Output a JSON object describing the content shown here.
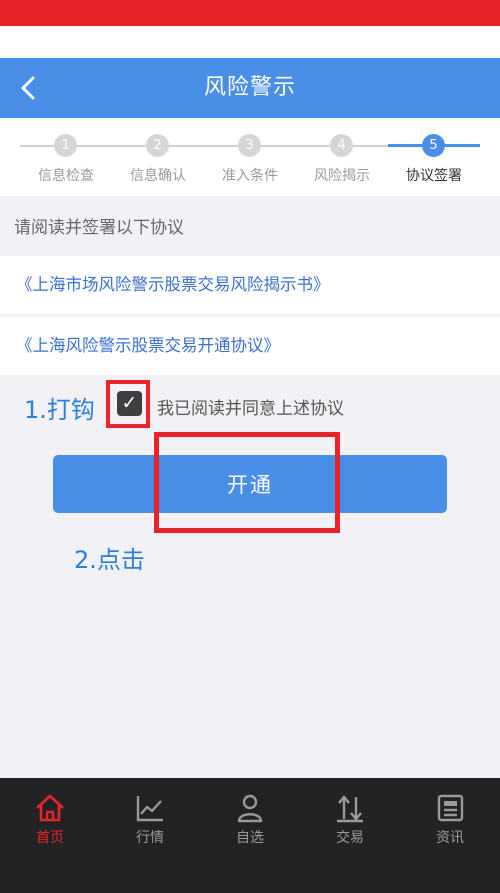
{
  "nav": {
    "title": "风险警示",
    "back_icon": "chevron-left-icon"
  },
  "steps": [
    {
      "num": "1",
      "label": "信息检查",
      "active": false
    },
    {
      "num": "2",
      "label": "信息确认",
      "active": false
    },
    {
      "num": "3",
      "label": "准入条件",
      "active": false
    },
    {
      "num": "4",
      "label": "风险揭示",
      "active": false
    },
    {
      "num": "5",
      "label": "协议签署",
      "active": true
    }
  ],
  "main": {
    "intro": "请阅读并签署以下协议",
    "protocols": [
      "《上海市场风险警示股票交易风险揭示书》",
      "《上海风险警示股票交易开通协议》"
    ],
    "agree_text": "我已阅读并同意上述协议",
    "agree_checked": true,
    "open_button": "开通"
  },
  "annotations": {
    "step1": "1.打钩",
    "step2": "2.点击",
    "highlight_color": "#e8232a",
    "text_color": "#2b7fd8"
  },
  "tabbar": [
    {
      "label": "首页",
      "icon": "home-icon",
      "active": true
    },
    {
      "label": "行情",
      "icon": "chart-icon",
      "active": false
    },
    {
      "label": "自选",
      "icon": "person-icon",
      "active": false
    },
    {
      "label": "交易",
      "icon": "transfer-icon",
      "active": false
    },
    {
      "label": "资讯",
      "icon": "news-icon",
      "active": false
    }
  ],
  "colors": {
    "accent": "#4a8fe7",
    "brand_red": "#e8232a",
    "tabbar_bg": "#222325"
  }
}
